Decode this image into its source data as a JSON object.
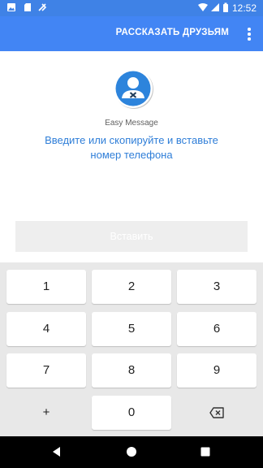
{
  "status_bar": {
    "time": "12:52",
    "icons": [
      "image-icon",
      "sd-card-icon",
      "bluetooth-icon",
      "wifi-icon",
      "cell-signal-icon",
      "battery-icon"
    ]
  },
  "app_bar": {
    "action_label": "РАССКАЗАТЬ ДРУЗЬЯМ",
    "menu_icon": "more-vert-icon",
    "color": "#4285f4"
  },
  "main": {
    "logo_icon": "contact-avatar-icon",
    "app_name": "Easy Message",
    "instruction_line1": "Введите или скопируйте и вставьте",
    "instruction_line2": "номер телефона",
    "paste_label": "Вставить",
    "accent_color": "#2f7ed8"
  },
  "keypad": {
    "keys": [
      "1",
      "2",
      "3",
      "4",
      "5",
      "6",
      "7",
      "8",
      "9",
      "+",
      "0"
    ],
    "backspace_icon": "backspace-icon"
  },
  "nav_bar": {
    "icons": [
      "back-icon",
      "home-icon",
      "recents-icon"
    ]
  }
}
